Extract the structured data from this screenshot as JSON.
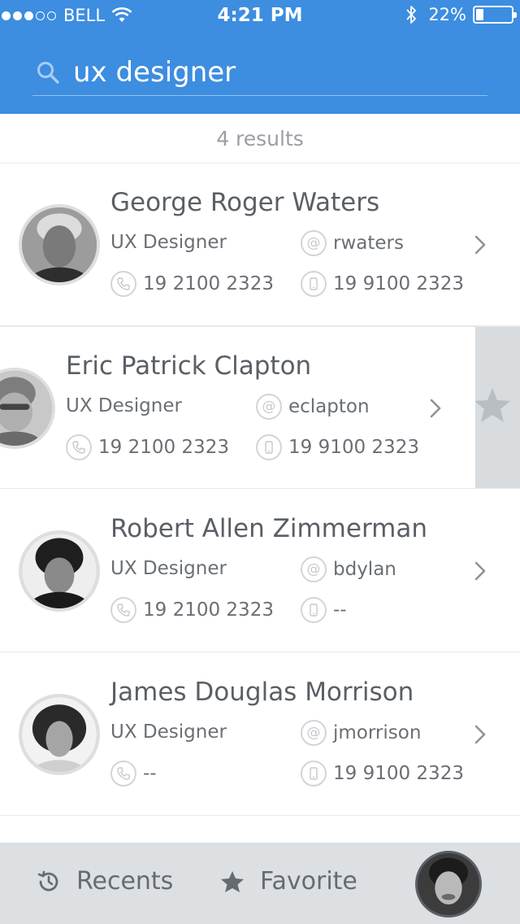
{
  "status_bar": {
    "carrier": "BELL",
    "time": "4:21 PM",
    "battery": "22%"
  },
  "search": {
    "query": "ux designer"
  },
  "results_count": "4 results",
  "contacts": [
    {
      "name": "George Roger Waters",
      "role": "UX Designer",
      "handle": "rwaters",
      "phone": "19 2100 2323",
      "mobile": "19 9100 2323"
    },
    {
      "name": "Eric Patrick Clapton",
      "role": "UX Designer",
      "handle": "eclapton",
      "phone": "19 2100 2323",
      "mobile": "19 9100 2323"
    },
    {
      "name": "Robert Allen Zimmerman",
      "role": "UX Designer",
      "handle": "bdylan",
      "phone": "19 2100 2323",
      "mobile": "--"
    },
    {
      "name": "James Douglas Morrison",
      "role": "UX Designer",
      "handle": "jmorrison",
      "phone": "--",
      "mobile": "19 9100 2323"
    }
  ],
  "tabbar": {
    "recents": "Recents",
    "favorite": "Favorite"
  },
  "icons": {
    "search": "search-icon",
    "email": "at-icon",
    "phone": "phone-icon",
    "mobile": "mobile-icon",
    "chevron": "chevron-right-icon",
    "recents": "history-icon",
    "favorite": "star-icon"
  },
  "colors": {
    "header": "#3d8de0",
    "tabbar": "#dde0e3",
    "swipe_action": "#d8dcdf"
  }
}
